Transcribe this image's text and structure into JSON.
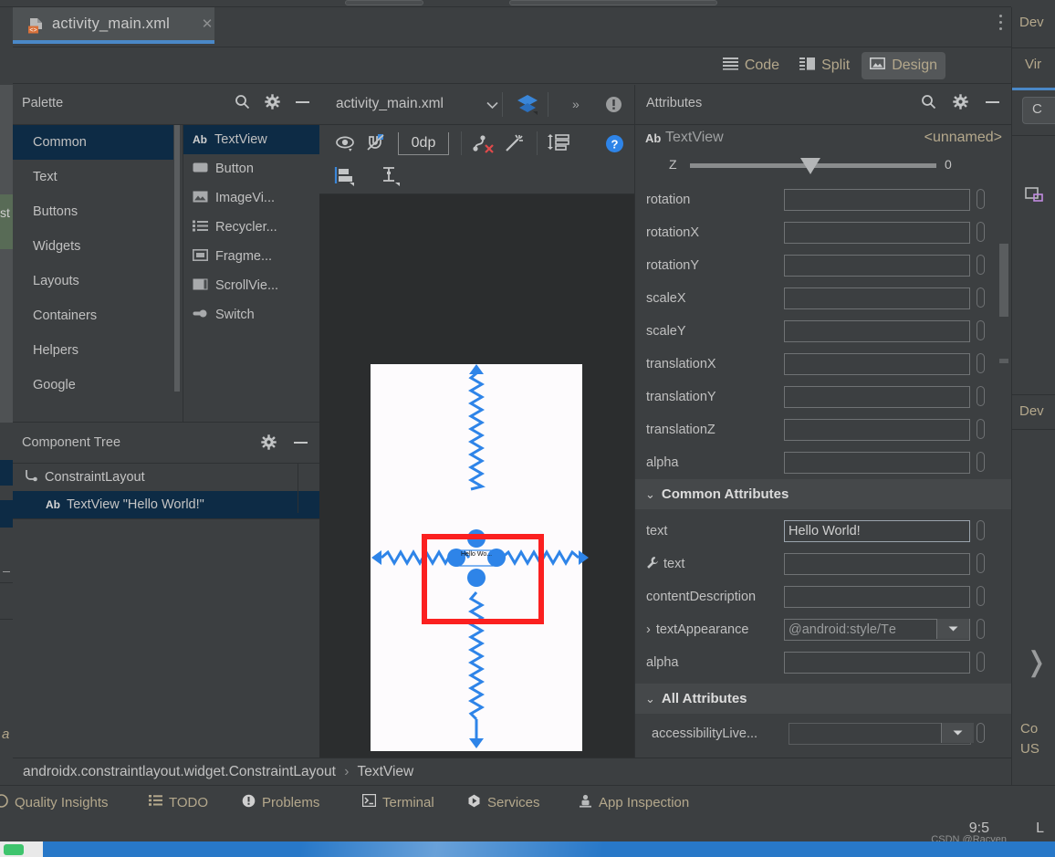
{
  "editor": {
    "tab_label": "activity_main.xml",
    "tab_icon": "xml-file-icon",
    "close_icon": "close-icon",
    "more_icon": "vertical-ellipsis-icon"
  },
  "modes": [
    {
      "label": "Code",
      "icon": "code-lines-icon",
      "active": false
    },
    {
      "label": "Split",
      "icon": "split-view-icon",
      "active": false
    },
    {
      "label": "Design",
      "icon": "design-image-icon",
      "active": true
    }
  ],
  "palette": {
    "title": "Palette",
    "search_icon": "search-icon",
    "settings_icon": "gear-icon",
    "minimize_icon": "minimize-icon",
    "categories": [
      {
        "label": "Common",
        "selected": true
      },
      {
        "label": "Text",
        "selected": false
      },
      {
        "label": "Buttons",
        "selected": false
      },
      {
        "label": "Widgets",
        "selected": false
      },
      {
        "label": "Layouts",
        "selected": false
      },
      {
        "label": "Containers",
        "selected": false
      },
      {
        "label": "Helpers",
        "selected": false
      },
      {
        "label": "Google",
        "selected": false
      }
    ],
    "items": [
      {
        "label": "TextView",
        "icon": "ab-text-icon",
        "selected": true
      },
      {
        "label": "Button",
        "icon": "button-icon",
        "selected": false
      },
      {
        "label": "ImageVi...",
        "icon": "image-icon",
        "selected": false
      },
      {
        "label": "Recycler...",
        "icon": "list-icon",
        "selected": false
      },
      {
        "label": "Fragme...",
        "icon": "fragment-icon",
        "selected": false
      },
      {
        "label": "ScrollVie...",
        "icon": "scrollview-icon",
        "selected": false
      },
      {
        "label": "Switch",
        "icon": "switch-icon",
        "selected": false
      }
    ]
  },
  "component_tree": {
    "title": "Component Tree",
    "settings_icon": "gear-icon",
    "minimize_icon": "minimize-icon",
    "nodes": [
      {
        "label": "ConstraintLayout",
        "icon": "constraintlayout-icon",
        "selected": false,
        "indent": 0
      },
      {
        "label": "TextView \"Hello World!\"",
        "icon": "ab-text-icon",
        "selected": true,
        "indent": 1
      }
    ]
  },
  "design_surface": {
    "file_name": "activity_main.xml",
    "file_chevron_icon": "chevron-down-icon",
    "layers_icon": "layers-icon",
    "overflow_label": "»",
    "warning_icon": "warning-icon",
    "toolbar": [
      {
        "icon": "eye-visibility-icon",
        "name": "design-view-mode"
      },
      {
        "icon": "magnet-off-icon",
        "name": "autoconnect-toggle"
      },
      {
        "icon": "default-margin-value",
        "name": "default-margin",
        "label": "0dp"
      },
      {
        "icon": "clear-constraints-icon",
        "name": "clear-all-constraints"
      },
      {
        "icon": "magic-wand-icon",
        "name": "infer-constraints"
      },
      {
        "icon": "pack-align-icon",
        "name": "pack-controls"
      },
      {
        "icon": "help-icon",
        "name": "help-button"
      },
      {
        "icon": "align-left-icon",
        "name": "align-controls"
      },
      {
        "icon": "guideline-icon",
        "name": "guideline-controls"
      }
    ],
    "preview": {
      "widget_text": "Hello Wo...",
      "selection_color": "#2e84e8",
      "annotation_color": "#fb2020",
      "constraints": [
        "top",
        "bottom",
        "start",
        "end"
      ]
    }
  },
  "attributes": {
    "title": "Attributes",
    "search_icon": "search-icon",
    "settings_icon": "gear-icon",
    "minimize_icon": "minimize-icon",
    "widget_type": "TextView",
    "widget_type_prefix": "Ab",
    "widget_id": "<unnamed>",
    "z_label": "Z",
    "z_value": "0",
    "transform_rows": [
      {
        "label": "rotation",
        "value": ""
      },
      {
        "label": "rotationX",
        "value": ""
      },
      {
        "label": "rotationY",
        "value": ""
      },
      {
        "label": "scaleX",
        "value": ""
      },
      {
        "label": "scaleY",
        "value": ""
      },
      {
        "label": "translationX",
        "value": ""
      },
      {
        "label": "translationY",
        "value": ""
      },
      {
        "label": "translationZ",
        "value": ""
      },
      {
        "label": "alpha",
        "value": ""
      }
    ],
    "common_section": {
      "title": "Common Attributes",
      "chevron_icon": "chevron-down-icon",
      "rows": [
        {
          "label": "text",
          "value": "Hello World!",
          "type": "text",
          "filled": true
        },
        {
          "label": "text",
          "value": "",
          "type": "text",
          "tool": true
        },
        {
          "label": "contentDescription",
          "value": "",
          "type": "text"
        },
        {
          "label": "textAppearance",
          "value": "@android:style/Tе",
          "type": "dropdown",
          "expandable": true
        },
        {
          "label": "alpha",
          "value": "",
          "type": "text"
        }
      ]
    },
    "all_section": {
      "title": "All Attributes",
      "chevron_icon": "chevron-down-icon",
      "rows": [
        {
          "label": "accessibilityLive...",
          "value": "",
          "type": "dropdown"
        }
      ]
    }
  },
  "breadcrumb": {
    "root": "androidx.constraintlayout.widget.ConstraintLayout",
    "separator": "›",
    "leaf": "TextView"
  },
  "tool_windows": [
    {
      "label": "Quality Insights",
      "icon": "quality-insights-icon"
    },
    {
      "label": "TODO",
      "icon": "todo-list-icon"
    },
    {
      "label": "Problems",
      "icon": "problems-icon"
    },
    {
      "label": "Terminal",
      "icon": "terminal-icon"
    },
    {
      "label": "Services",
      "icon": "services-play-icon"
    },
    {
      "label": "App Inspection",
      "icon": "app-inspection-icon"
    }
  ],
  "status_bar": {
    "clock": "9:5",
    "watermark": "CSDN @Racyen",
    "trailing": "L"
  },
  "right_dock": {
    "device_label": "Dev",
    "virtual_label": "Vir",
    "button_label": "C",
    "device_icon": "device-icon",
    "device_label2": "Dev",
    "chevron_icon": "chevron-right-icon",
    "connect_line1": "Co",
    "connect_line2": "US"
  },
  "left_dock": {
    "fragment_text": "st",
    "italic_text": "a"
  },
  "colors": {
    "accent_blue": "#4a88c7",
    "selection_navy": "#0d2b45",
    "panel": "#3c3f41",
    "canvas": "#2b2d2e",
    "label_gold": "#b4a88c",
    "constraint_blue": "#2e84e8",
    "annotation_red": "#fb2020"
  }
}
